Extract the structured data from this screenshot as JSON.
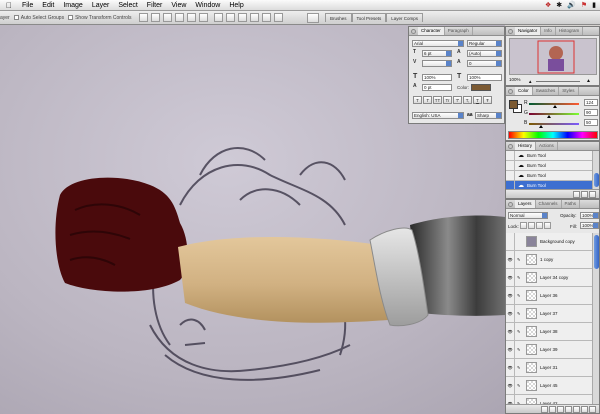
{
  "menubar": {
    "apple": "",
    "items": [
      "File",
      "Edit",
      "Image",
      "Layer",
      "Select",
      "Filter",
      "View",
      "Window",
      "Help"
    ],
    "status_icons": [
      "script-icon",
      "bluetooth-icon",
      "volume-icon",
      "flag-icon",
      "battery-icon"
    ]
  },
  "options_bar": {
    "tool_label": "ayer",
    "auto_select": "Auto Select Groups",
    "show_transform": "Show Transform Controls",
    "well_tabs": [
      "Brushes",
      "Tool Presets",
      "Layer Comps"
    ]
  },
  "character": {
    "tabs": [
      "Character",
      "Paragraph"
    ],
    "font_family": "Arial",
    "font_style": "Regular",
    "size": "6 pt",
    "leading": "(Auto)",
    "kerning": "",
    "tracking": "0",
    "vscale": "100%",
    "hscale": "100%",
    "baseline": "0 pt",
    "color_label": "Color:",
    "style_buttons": [
      "T",
      "T",
      "TT",
      "Tr",
      "T'",
      "T,",
      "T",
      "Ŧ"
    ],
    "language": "English: USA",
    "aa_label": "aa",
    "antialias": "Sharp"
  },
  "navigator": {
    "tabs": [
      "Navigator",
      "Info",
      "Histogram"
    ],
    "zoom": "100%"
  },
  "color": {
    "tabs": [
      "Color",
      "Swatches",
      "Styles"
    ],
    "channels": [
      {
        "label": "R",
        "value": "124",
        "level": 0.486
      },
      {
        "label": "G",
        "value": "90",
        "level": 0.353
      },
      {
        "label": "B",
        "value": "50",
        "level": 0.196
      }
    ],
    "fg": "#7c5a32"
  },
  "history": {
    "tabs": [
      "History",
      "Actions"
    ],
    "items": [
      "Burn Tool",
      "Burn Tool",
      "Burn Tool",
      "Burn Tool"
    ],
    "selected_index": 3
  },
  "layers": {
    "tabs": [
      "Layers",
      "Channels",
      "Paths"
    ],
    "blend": "Normal",
    "opacity_label": "Opacity:",
    "opacity": "100%",
    "lock_label": "Lock:",
    "fill_label": "Fill:",
    "fill": "100%",
    "rows": [
      {
        "name": "Background copy",
        "kind": "image"
      },
      {
        "name": "1 copy",
        "kind": "blank"
      },
      {
        "name": "Layer 34 copy",
        "kind": "blank"
      },
      {
        "name": "Layer 36",
        "kind": "blank"
      },
      {
        "name": "Layer 37",
        "kind": "blank"
      },
      {
        "name": "Layer 38",
        "kind": "blank"
      },
      {
        "name": "Layer 39",
        "kind": "blank"
      },
      {
        "name": "Layer 31",
        "kind": "blank"
      },
      {
        "name": "Layer 45",
        "kind": "blank"
      },
      {
        "name": "Layer 42",
        "kind": "blank"
      }
    ]
  }
}
